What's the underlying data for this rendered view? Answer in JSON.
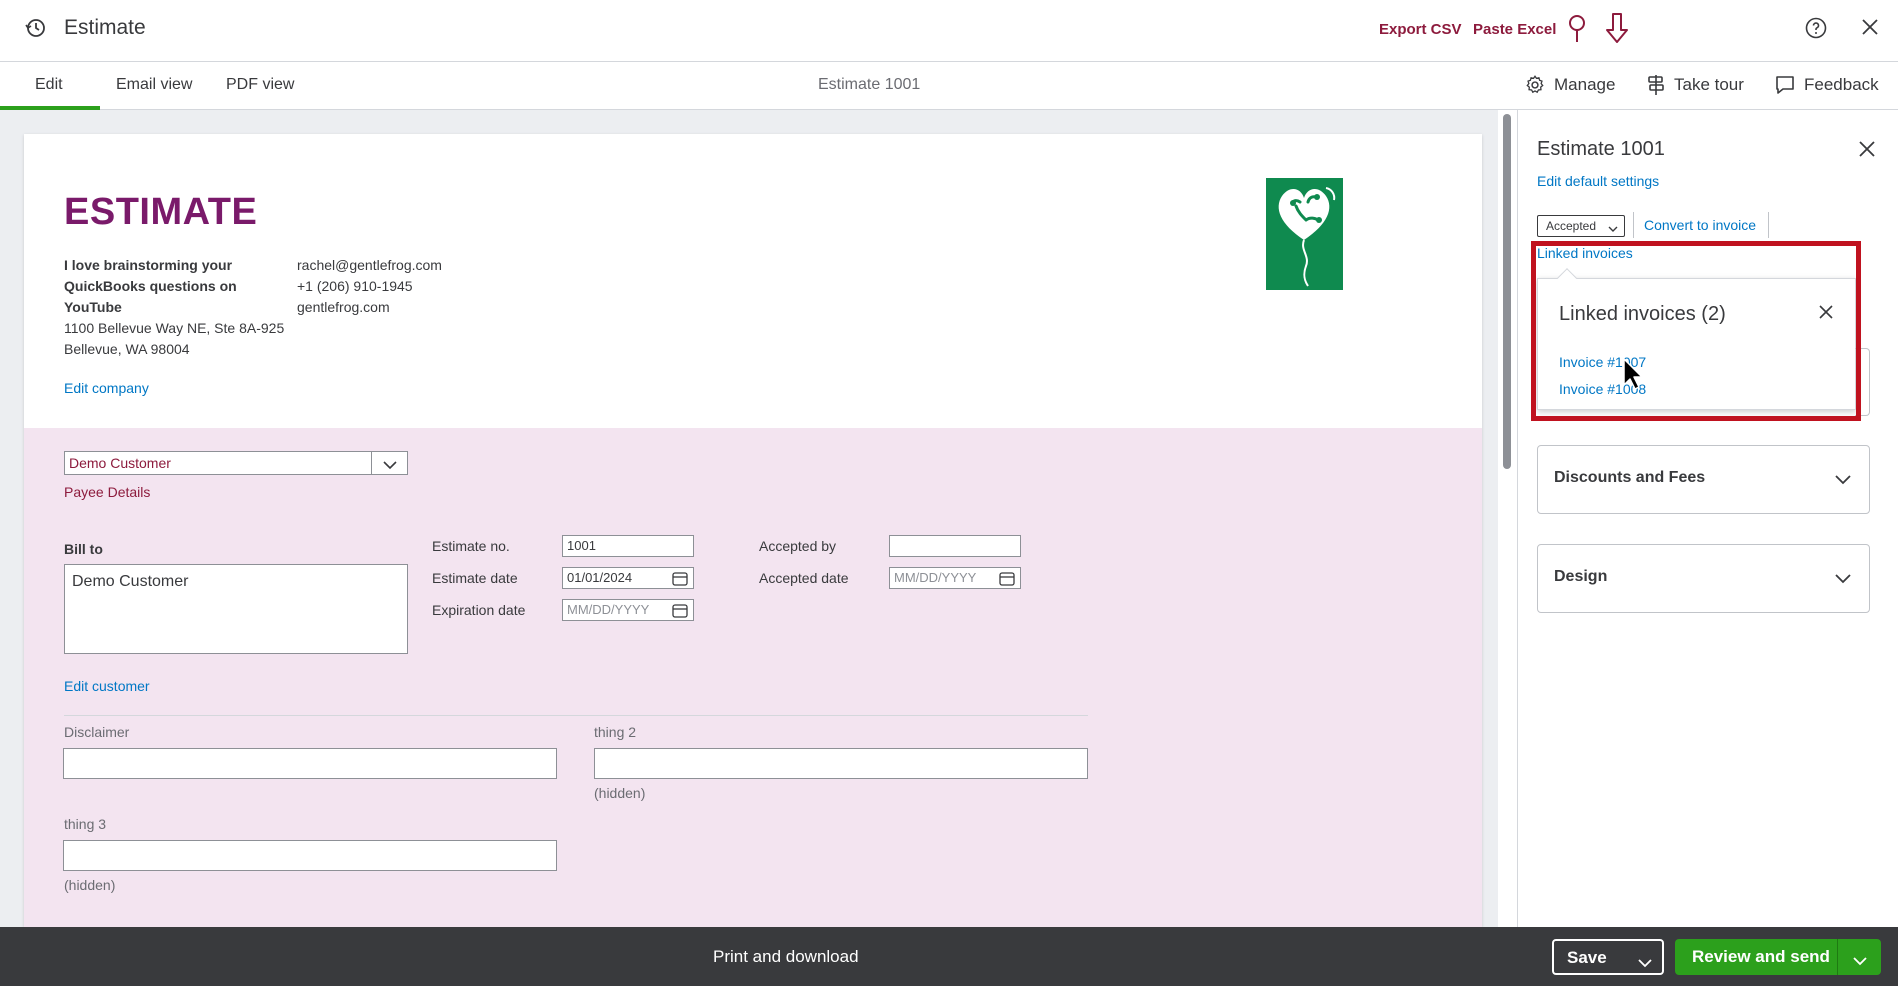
{
  "topbar": {
    "title": "Estimate",
    "export_csv": "Export CSV",
    "paste_excel": "Paste Excel",
    "accent_color": "#8d1b3d"
  },
  "tabs": [
    {
      "label": "Edit",
      "active": true
    },
    {
      "label": "Email view",
      "active": false
    },
    {
      "label": "PDF view",
      "active": false
    }
  ],
  "doc_title": "Estimate 1001",
  "tools": {
    "manage": "Manage",
    "take_tour": "Take tour",
    "feedback": "Feedback"
  },
  "form": {
    "heading": "ESTIMATE",
    "heading_color": "#7a1a6a",
    "company_name_lines": [
      "I love brainstorming your",
      "QuickBooks questions on",
      "YouTube"
    ],
    "address_lines": [
      "1100 Bellevue Way NE, Ste 8A-925",
      "Bellevue, WA 98004"
    ],
    "email": "rachel@gentlefrog.com",
    "phone": "+1 (206) 910-1945",
    "website": "gentlefrog.com",
    "edit_company": "Edit company",
    "customer": "Demo Customer",
    "payee_details": "Payee Details",
    "bill_to_label": "Bill to",
    "bill_to_value": "Demo Customer",
    "estimate_no_label": "Estimate no.",
    "estimate_no": "1001",
    "estimate_date_label": "Estimate date",
    "estimate_date": "01/01/2024",
    "expiration_date_label": "Expiration date",
    "expiration_date_placeholder": "MM/DD/YYYY",
    "accepted_by_label": "Accepted by",
    "accepted_by": "",
    "accepted_date_label": "Accepted date",
    "accepted_date_placeholder": "MM/DD/YYYY",
    "edit_customer": "Edit customer",
    "custom_fields": [
      {
        "label": "Disclaimer",
        "value": "",
        "note": ""
      },
      {
        "label": "thing 2",
        "value": "",
        "note": "(hidden)"
      },
      {
        "label": "thing 3",
        "value": "",
        "note": "(hidden)"
      }
    ]
  },
  "panel": {
    "title": "Estimate 1001",
    "edit_default": "Edit default settings",
    "status": "Accepted",
    "convert": "Convert to invoice",
    "linked_link": "Linked invoices",
    "popover": {
      "title": "Linked invoices (2)",
      "invoices": [
        "Invoice #1007",
        "Invoice #1008"
      ]
    },
    "sections": [
      {
        "label": "Discounts and Fees"
      },
      {
        "label": "Design"
      }
    ],
    "highlight_color": "#c0121f"
  },
  "bottombar": {
    "print": "Print and download",
    "save": "Save",
    "review_send": "Review and send",
    "primary_color": "#2ca01c"
  },
  "icons": [
    "history-icon",
    "pin-icon",
    "download-arrow-icon",
    "help-icon",
    "close-icon",
    "gear-icon",
    "tour-icon",
    "feedback-icon",
    "calendar-icon",
    "chevron-down-icon",
    "cursor-icon",
    "frog-logo"
  ]
}
